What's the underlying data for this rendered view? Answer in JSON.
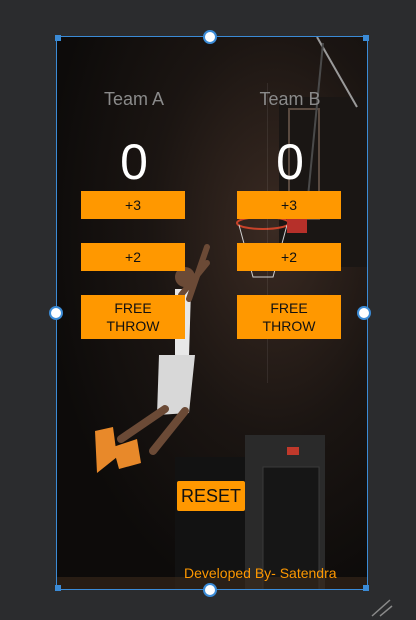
{
  "team_a": {
    "name": "Team A",
    "score": "0",
    "btn_three": "+3",
    "btn_two": "+2",
    "btn_free": "FREE\nTHROW"
  },
  "team_b": {
    "name": "Team B",
    "score": "0",
    "btn_three": "+3",
    "btn_two": "+2",
    "btn_free": "FREE\nTHROW"
  },
  "reset_label": "RESET",
  "footer_text": "Developed By- Satendra",
  "colors": {
    "accent": "#ff9800",
    "selection": "#3b8bd6",
    "editor_bg": "#2b2c2e"
  }
}
